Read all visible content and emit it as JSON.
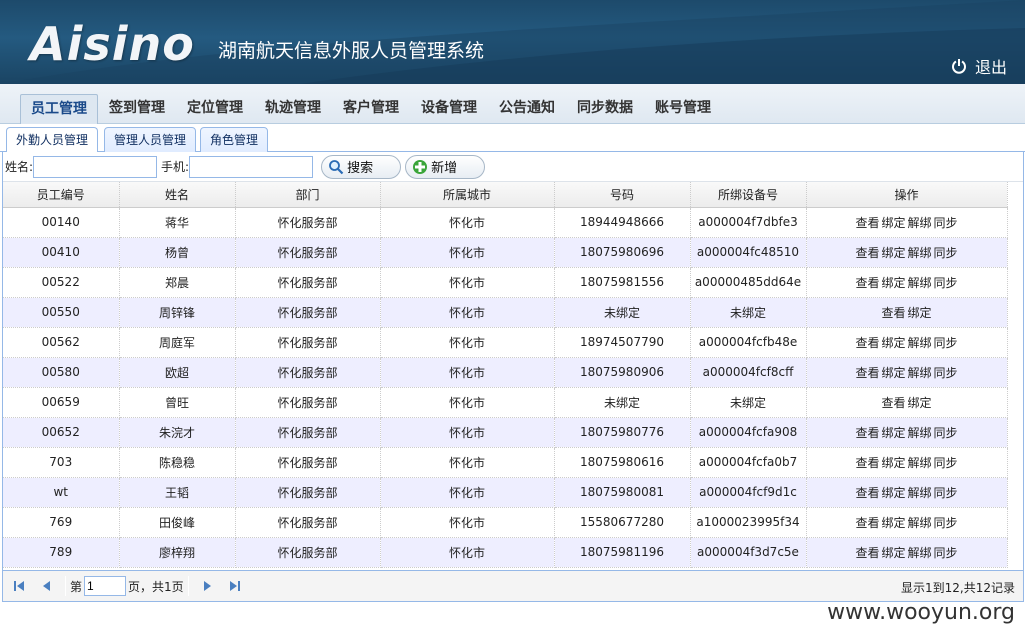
{
  "header": {
    "logo": "Aisino",
    "title": "湖南航天信息外服人员管理系统",
    "logout": "退出"
  },
  "nav": {
    "items": [
      "员工管理",
      "签到管理",
      "定位管理",
      "轨迹管理",
      "客户管理",
      "设备管理",
      "公告通知",
      "同步数据",
      "账号管理"
    ],
    "active": 0
  },
  "subtabs": [
    "外勤人员管理",
    "管理人员管理",
    "角色管理"
  ],
  "toolbar": {
    "name_label": "姓名:",
    "phone_label": "手机:",
    "name_value": "",
    "phone_value": "",
    "search_label": "搜索",
    "add_label": "新增"
  },
  "table": {
    "columns": [
      "员工编号",
      "姓名",
      "部门",
      "所属城市",
      "号码",
      "所绑设备号",
      "操作"
    ],
    "rows": [
      {
        "id": "00140",
        "name": "蒋华",
        "dept": "怀化服务部",
        "city": "怀化市",
        "phone": "18944948666",
        "device": "a000004f7dbfe3",
        "ops": [
          "查看",
          "绑定",
          "解绑",
          "同步"
        ]
      },
      {
        "id": "00410",
        "name": "杨曾",
        "dept": "怀化服务部",
        "city": "怀化市",
        "phone": "18075980696",
        "device": "a000004fc48510",
        "ops": [
          "查看",
          "绑定",
          "解绑",
          "同步"
        ]
      },
      {
        "id": "00522",
        "name": "郑晨",
        "dept": "怀化服务部",
        "city": "怀化市",
        "phone": "18075981556",
        "device": "a00000485dd64e",
        "ops": [
          "查看",
          "绑定",
          "解绑",
          "同步"
        ]
      },
      {
        "id": "00550",
        "name": "周锌锋",
        "dept": "怀化服务部",
        "city": "怀化市",
        "phone": "未绑定",
        "device": "未绑定",
        "ops": [
          "查看",
          "绑定"
        ]
      },
      {
        "id": "00562",
        "name": "周庭军",
        "dept": "怀化服务部",
        "city": "怀化市",
        "phone": "18974507790",
        "device": "a000004fcfb48e",
        "ops": [
          "查看",
          "绑定",
          "解绑",
          "同步"
        ]
      },
      {
        "id": "00580",
        "name": "欧超",
        "dept": "怀化服务部",
        "city": "怀化市",
        "phone": "18075980906",
        "device": "a000004fcf8cff",
        "ops": [
          "查看",
          "绑定",
          "解绑",
          "同步"
        ]
      },
      {
        "id": "00659",
        "name": "曾旺",
        "dept": "怀化服务部",
        "city": "怀化市",
        "phone": "未绑定",
        "device": "未绑定",
        "ops": [
          "查看",
          "绑定"
        ]
      },
      {
        "id": "00652",
        "name": "朱浣才",
        "dept": "怀化服务部",
        "city": "怀化市",
        "phone": "18075980776",
        "device": "a000004fcfa908",
        "ops": [
          "查看",
          "绑定",
          "解绑",
          "同步"
        ]
      },
      {
        "id": "703",
        "name": "陈稳稳",
        "dept": "怀化服务部",
        "city": "怀化市",
        "phone": "18075980616",
        "device": "a000004fcfa0b7",
        "ops": [
          "查看",
          "绑定",
          "解绑",
          "同步"
        ]
      },
      {
        "id": "wt",
        "name": "王韬",
        "dept": "怀化服务部",
        "city": "怀化市",
        "phone": "18075980081",
        "device": "a000004fcf9d1c",
        "ops": [
          "查看",
          "绑定",
          "解绑",
          "同步"
        ]
      },
      {
        "id": "769",
        "name": "田俊峰",
        "dept": "怀化服务部",
        "city": "怀化市",
        "phone": "15580677280",
        "device": "a1000023995f34",
        "ops": [
          "查看",
          "绑定",
          "解绑",
          "同步"
        ]
      },
      {
        "id": "789",
        "name": "廖梓翔",
        "dept": "怀化服务部",
        "city": "怀化市",
        "phone": "18075981196",
        "device": "a000004f3d7c5e",
        "ops": [
          "查看",
          "绑定",
          "解绑",
          "同步"
        ]
      }
    ]
  },
  "pager": {
    "page_prefix": "第",
    "page_value": "1",
    "page_suffix": "页，共1页",
    "info": "显示1到12,共12记录"
  },
  "watermark": "www.wooyun.org",
  "colors": {
    "header_bg": "#245a80",
    "border": "#95b8e7",
    "alt_row": "#eeeeff",
    "active_nav_text": "#1a4a8a"
  }
}
